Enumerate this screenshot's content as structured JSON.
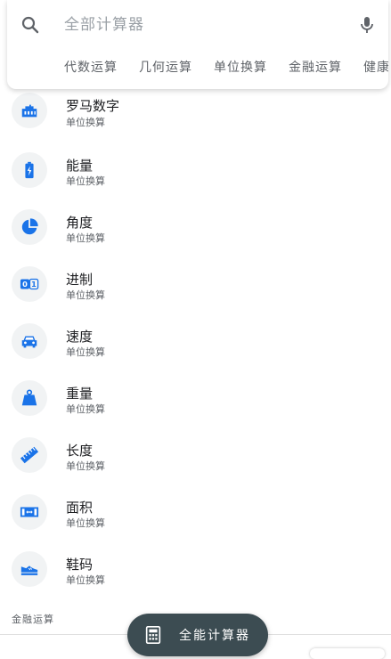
{
  "search": {
    "placeholder": "全部计算器",
    "chips": [
      "代数运算",
      "几何运算",
      "单位换算",
      "金融运算",
      "健康"
    ]
  },
  "items": [
    {
      "title": "罗马数字",
      "subtitle": "单位换算",
      "icon": "roman-numeral-icon"
    },
    {
      "title": "能量",
      "subtitle": "单位换算",
      "icon": "battery-icon"
    },
    {
      "title": "角度",
      "subtitle": "单位换算",
      "icon": "pie-angle-icon"
    },
    {
      "title": "进制",
      "subtitle": "单位换算",
      "icon": "binary-icon"
    },
    {
      "title": "速度",
      "subtitle": "单位换算",
      "icon": "car-icon"
    },
    {
      "title": "重量",
      "subtitle": "单位换算",
      "icon": "weight-icon"
    },
    {
      "title": "长度",
      "subtitle": "单位换算",
      "icon": "ruler-icon"
    },
    {
      "title": "面积",
      "subtitle": "单位换算",
      "icon": "area-icon"
    },
    {
      "title": "鞋码",
      "subtitle": "单位换算",
      "icon": "shoe-icon"
    }
  ],
  "section_label": "金融运算",
  "fab": {
    "label": "全能计算器",
    "icon": "calculator-icon"
  },
  "colors": {
    "accent": "#1a73e8",
    "fab_bg": "#3c4c52",
    "icon_bg": "#f1f3f4"
  }
}
